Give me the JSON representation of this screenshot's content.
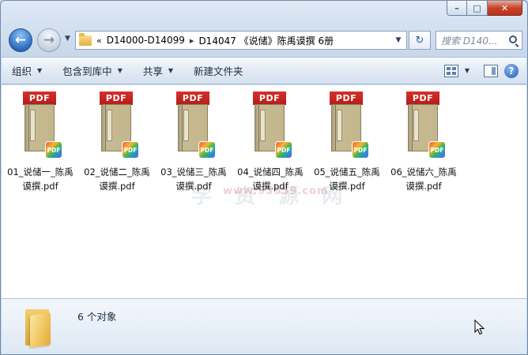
{
  "window": {
    "caption": {
      "minimize": "–",
      "maximize": "□",
      "close": "✕"
    }
  },
  "nav": {
    "back_glyph": "←",
    "forward_glyph": "→",
    "recent_glyph": "▼"
  },
  "address": {
    "prefix": "«",
    "crumbs": [
      "D14000-D14099",
      "D14047 《说储》陈禹谟撰 6册"
    ],
    "separator": "▸",
    "dropdown": "▼",
    "refresh": "↻"
  },
  "search": {
    "placeholder": "搜索 D140..."
  },
  "toolbar": {
    "organize": "组织",
    "include_in_library": "包含到库中",
    "share": "共享",
    "new_folder": "新建文件夹",
    "dropdown_arrow": "▼",
    "help": "?"
  },
  "files": [
    {
      "line1": "01_说储一_陈禹",
      "line2": "谟撰.pdf",
      "badge": "PDF",
      "banner": "PDF"
    },
    {
      "line1": "02_说储二_陈禹",
      "line2": "谟撰.pdf",
      "badge": "PDF",
      "banner": "PDF"
    },
    {
      "line1": "03_说储三_陈禹",
      "line2": "谟撰.pdf",
      "badge": "PDF",
      "banner": "PDF"
    },
    {
      "line1": "04_说储四_陈禹",
      "line2": "谟撰.pdf",
      "badge": "PDF",
      "banner": "PDF"
    },
    {
      "line1": "05_说储五_陈禹",
      "line2": "谟撰.pdf",
      "badge": "PDF",
      "banner": "PDF"
    },
    {
      "line1": "06_说储六_陈禹",
      "line2": "谟撰.pdf",
      "badge": "PDF",
      "banner": "PDF"
    }
  ],
  "watermark": {
    "text": "学 资 源 网",
    "sub": "www.95959.com"
  },
  "status": {
    "count": "6 个对象"
  },
  "colors": {
    "accent": "#2c6bbd",
    "pdf_red": "#c8241f",
    "close_red": "#c7432b"
  }
}
